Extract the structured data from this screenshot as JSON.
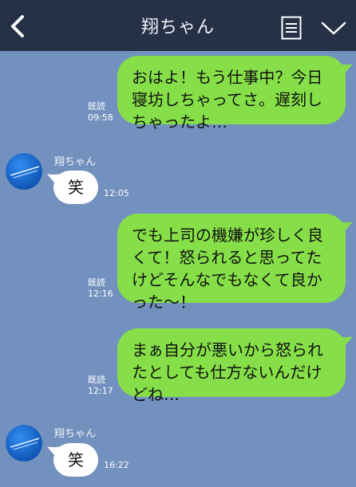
{
  "header": {
    "title": "翔ちゃん",
    "back_icon": "chevron-left-icon",
    "menu_icon": "document-list-icon",
    "toggle_icon": "chevron-down-icon"
  },
  "messages": [
    {
      "text": "おはよ！もう仕事中？今日寝坊しちゃってさ。遅刻しちゃったよ…",
      "line1": "おはよ！もう仕事中？今日",
      "line2": "寝坊しちゃってさ。遅刻し",
      "line3": "ちゃったよ…",
      "read": "既読",
      "time": "09:58"
    },
    {
      "sender": "翔ちゃん",
      "text": "笑",
      "time": "12:05"
    },
    {
      "text": "でも上司の機嫌が珍しく良くて！怒られると思ってたけどそんなでもなくて良かった〜！",
      "line1": "でも上司の機嫌が珍しく良",
      "line2": "くて！怒られると思ってた",
      "line3": "けどそんなでもなくて良か",
      "line4": "った〜！",
      "read": "既読",
      "time": "12:16"
    },
    {
      "text": "まぁ自分が悪いから怒られたとしても仕方ないんだけどね…",
      "line1": "まぁ自分が悪いから怒られ",
      "line2": "たとしても仕方ないんだけ",
      "line3": "どね…",
      "read": "既読",
      "time": "12:17"
    },
    {
      "sender": "翔ちゃん",
      "text": "笑",
      "time": "16:22"
    }
  ],
  "colors": {
    "background": "#7391be",
    "header": "#263046",
    "my_bubble": "#86df48",
    "their_bubble": "#ffffff"
  }
}
